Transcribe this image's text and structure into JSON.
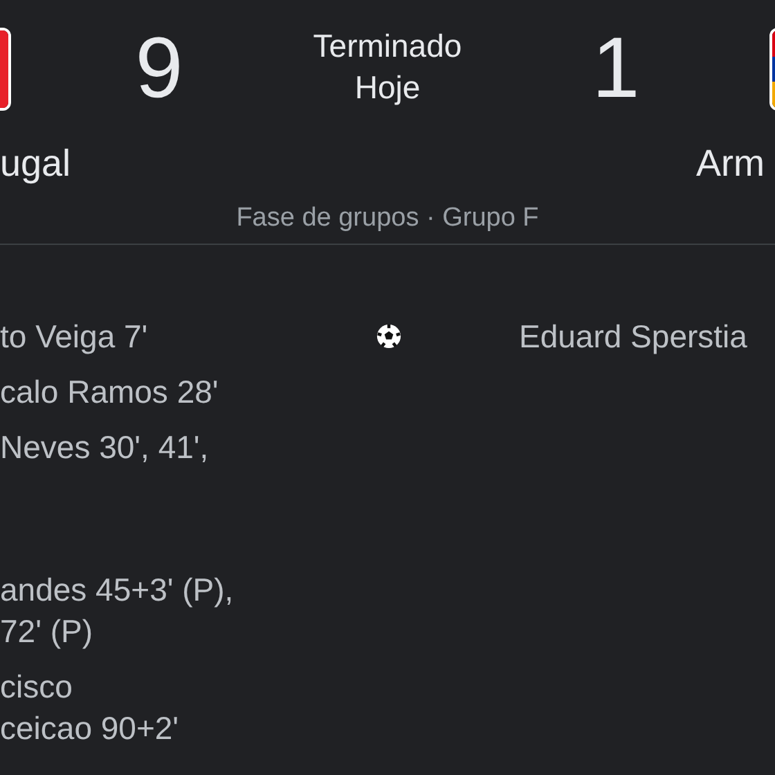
{
  "match": {
    "status": "Terminado",
    "date": "Hoje",
    "stage": "Fase de grupos · Grupo F"
  },
  "home": {
    "name": "ugal",
    "score": "9"
  },
  "away": {
    "name": "Arm",
    "score": "1"
  },
  "goals": {
    "home": [
      {
        "lines": [
          "to Veiga 7'"
        ]
      },
      {
        "lines": [
          "calo Ramos 28'"
        ]
      },
      {
        "lines": [
          "Neves 30', 41',"
        ]
      },
      {
        "lines": [
          "andes 45+3' (P),",
          "72' (P)"
        ]
      },
      {
        "lines": [
          "cisco",
          "ceicao 90+2'"
        ]
      }
    ],
    "away": [
      {
        "lines": [
          "Eduard Sperstia"
        ]
      }
    ]
  }
}
